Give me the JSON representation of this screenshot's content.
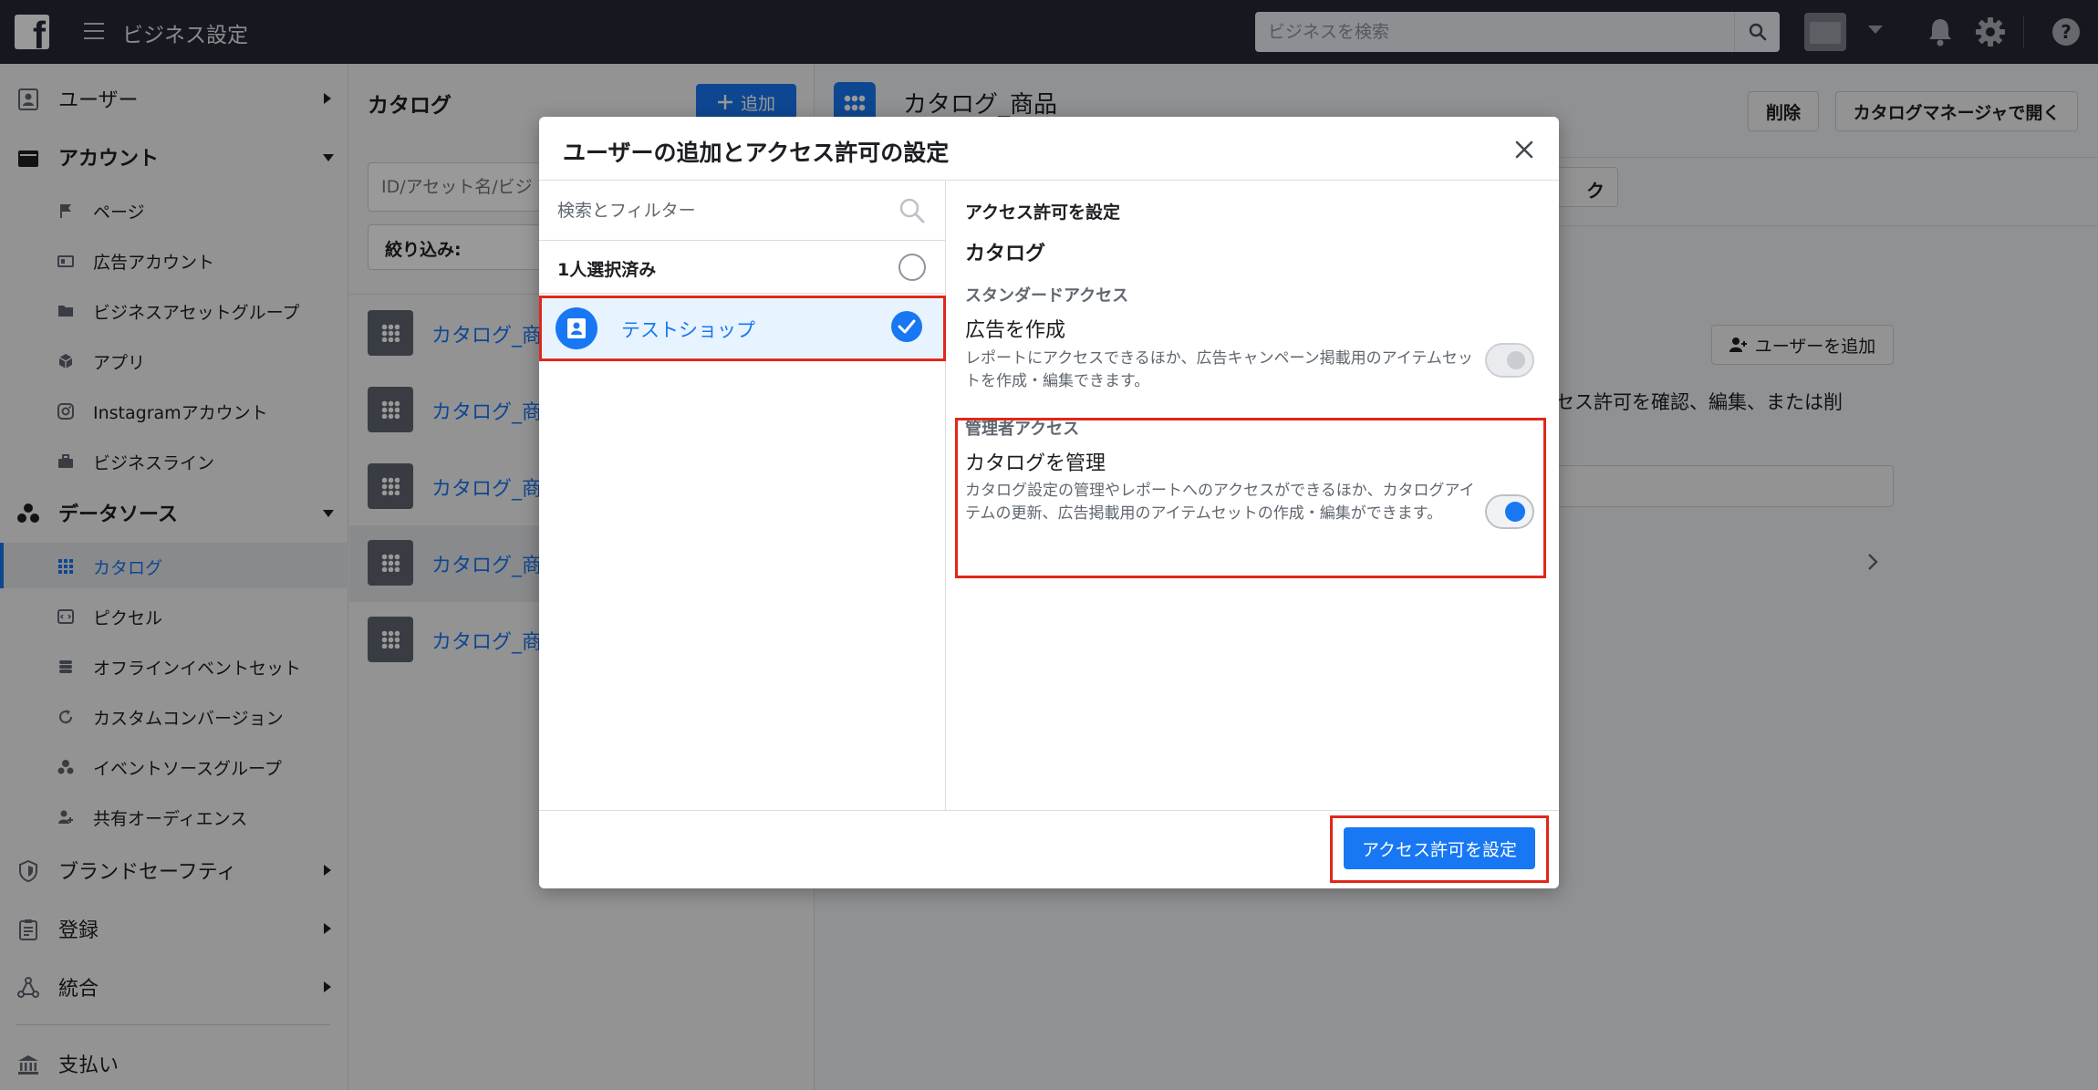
{
  "topbar": {
    "title": "ビジネス設定",
    "search_placeholder": "ビジネスを検索",
    "help_label": "?"
  },
  "sidebar": {
    "items": [
      {
        "label": "ユーザー"
      },
      {
        "label": "アカウント"
      },
      {
        "label": "ページ"
      },
      {
        "label": "広告アカウント"
      },
      {
        "label": "ビジネスアセットグループ"
      },
      {
        "label": "アプリ"
      },
      {
        "label": "Instagramアカウント"
      },
      {
        "label": "ビジネスライン"
      },
      {
        "label": "データソース"
      },
      {
        "label": "カタログ"
      },
      {
        "label": "ピクセル"
      },
      {
        "label": "オフラインイベントセット"
      },
      {
        "label": "カスタムコンバージョン"
      },
      {
        "label": "イベントソースグループ"
      },
      {
        "label": "共有オーディエンス"
      },
      {
        "label": "ブランドセーフティ"
      },
      {
        "label": "登録"
      },
      {
        "label": "統合"
      },
      {
        "label": "支払い"
      }
    ]
  },
  "middle": {
    "title": "カタログ",
    "add_label": "追加",
    "search_placeholder": "ID/アセット名/ビジ",
    "filter_label": "絞り込み:",
    "catalogs": [
      {
        "name": "カタログ_商"
      },
      {
        "name": "カタログ_商"
      },
      {
        "name": "カタログ_商"
      },
      {
        "name": "カタログ_商"
      },
      {
        "name": "カタログ_商"
      }
    ]
  },
  "detail": {
    "title": "カタログ_商品",
    "delete_label": "削除",
    "open_manager_label": "カタログマネージャで開く",
    "tab_fragment": "ク",
    "add_user_label": "ユーザーを追加",
    "description_fragment": "クセス許可を確認、編集、または削"
  },
  "modal": {
    "title": "ユーザーの追加とアクセス許可の設定",
    "search_placeholder": "検索とフィルター",
    "selected_count": "1人選択済み",
    "user_name": "テストショップ",
    "right": {
      "heading": "アクセス許可を設定",
      "asset_type": "カタログ",
      "standard_section": "スタンダードアクセス",
      "standard_perm_title": "広告を作成",
      "standard_perm_desc": "レポートにアクセスできるほか、広告キャンペーン掲載用のアイテムセットを作成・編集できます。",
      "admin_section": "管理者アクセス",
      "admin_perm_title": "カタログを管理",
      "admin_perm_desc": "カタログ設定の管理やレポートへのアクセスができるほか、カタログアイテムの更新、広告掲載用のアイテムセットの作成・編集ができます。"
    },
    "standard_toggle_on": false,
    "admin_toggle_on": true,
    "submit_label": "アクセス許可を設定"
  },
  "colors": {
    "accent": "#1877f2",
    "topbar": "#232a35",
    "highlight": "#e0281a"
  }
}
